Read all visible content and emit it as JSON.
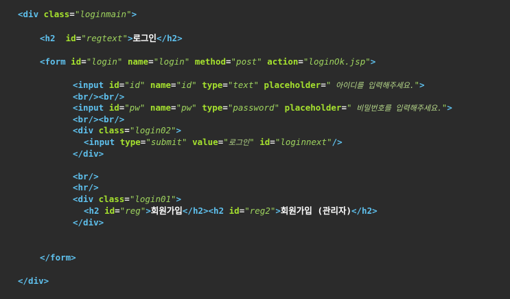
{
  "code": {
    "l1": {
      "open": "<div",
      "a1": "class",
      "v1": "\"loginmain\"",
      "close": ">"
    },
    "l2": {
      "open": "<h2",
      "a1": "id",
      "v1": "\"regtext\"",
      "mid": ">",
      "text": "로그인",
      "end": "</h2>"
    },
    "l3": {
      "open": "<form",
      "a1": "id",
      "v1": "\"login\"",
      "a2": "name",
      "v2": "\"login\"",
      "a3": "method",
      "v3": "\"post\"",
      "a4": "action",
      "v4": "\"loginOk.jsp\"",
      "close": ">"
    },
    "l4": {
      "open": "<input",
      "a1": "id",
      "v1": "\"id\"",
      "a2": "name",
      "v2": "\"id\"",
      "a3": "type",
      "v3": "\"text\"",
      "a4": "placeholder",
      "v4q": "\"",
      "v4": " 아이디를 입력해주세요.",
      "v4e": "\"",
      "close": ">"
    },
    "l5": {
      "text": "<br/><br/>"
    },
    "l6": {
      "open": "<input",
      "a1": "id",
      "v1": "\"pw\"",
      "a2": "name",
      "v2": "\"pw\"",
      "a3": "type",
      "v3": "\"password\"",
      "a4": "placeholder",
      "v4q": "\"",
      "v4": " 비밀번호를 입력해주세요.",
      "v4e": "\"",
      "close": ">"
    },
    "l7": {
      "text": "<br/><br/>"
    },
    "l8": {
      "open": "<div",
      "a1": "class",
      "v1": "\"login02\"",
      "close": ">"
    },
    "l9": {
      "open": "<input",
      "a1": "type",
      "v1": "\"submit\"",
      "a2": "value",
      "v2q": "\"",
      "v2": "로그인",
      "v2e": "\"",
      "a3": "id",
      "v3": "\"loginnext\"",
      "close": "/>"
    },
    "l10": {
      "text": "</div>"
    },
    "l11": {
      "text": "<br/>"
    },
    "l12": {
      "text": "<hr/>"
    },
    "l13": {
      "open": "<div",
      "a1": "class",
      "v1": "\"login01\"",
      "close": ">"
    },
    "l14": {
      "open": "<h2",
      "a1": "id",
      "v1": "\"reg\"",
      "mid": ">",
      "text": "회원가입",
      "end": "</h2>",
      "open2": "<h2",
      "a2": "id",
      "v2": "\"reg2\"",
      "mid2": ">",
      "text2": "회원가입 (관리자)",
      "end2": "</h2>"
    },
    "l15": {
      "text": "</div>"
    },
    "l16": {
      "text": "</form>"
    },
    "l17": {
      "text": "</div>"
    }
  },
  "colors": {
    "background": "#2b2b2b",
    "tag": "#5fc1ee",
    "attribute": "#a6e22e",
    "value": "#9ed35e",
    "text": "#ffffff"
  }
}
